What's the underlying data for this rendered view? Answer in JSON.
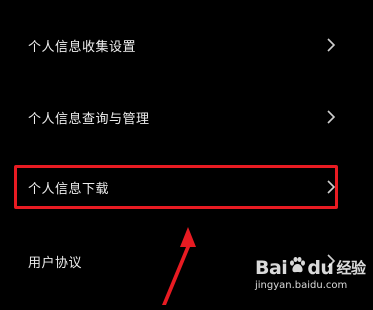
{
  "menu": {
    "items": [
      {
        "label": "个人信息收集设置"
      },
      {
        "label": "个人信息查询与管理"
      },
      {
        "label": "个人信息下载"
      },
      {
        "label": "用户协议"
      }
    ]
  },
  "annotation": {
    "highlight_color": "#e81b22",
    "highlighted_item": "个人信息下载"
  },
  "watermark": {
    "brand_left": "Bai",
    "brand_right": "du",
    "brand_suffix": "经验",
    "url": "jingyan.baidu.com"
  },
  "icons": {
    "row_chevron": "chevron-right-icon",
    "watermark_paw": "baidu-paw-icon"
  }
}
